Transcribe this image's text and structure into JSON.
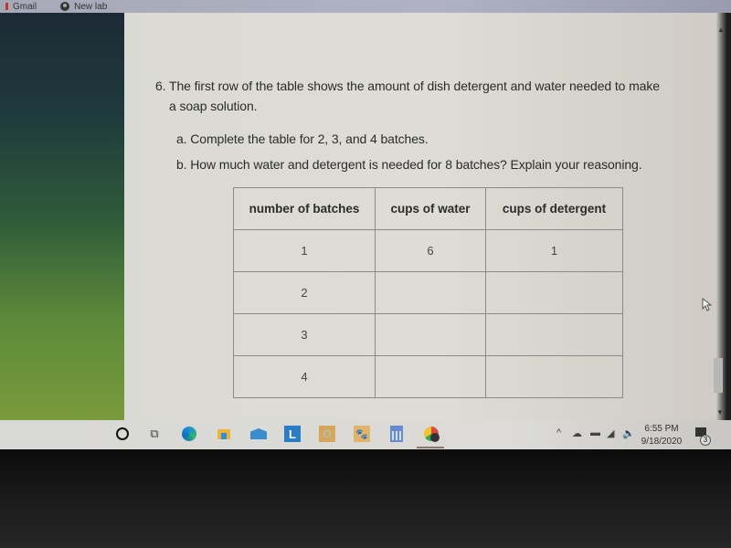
{
  "bookmarks": [
    {
      "label": "Gmail",
      "icon": "gmail-icon"
    },
    {
      "label": "New lab",
      "icon": "globe-icon"
    }
  ],
  "document": {
    "question_line1": "6. The first row of the table shows the amount of dish detergent and water needed to make",
    "question_line2": "a soap solution.",
    "part_a": "a. Complete the table for 2, 3, and 4 batches.",
    "part_b": "b. How much water and detergent is needed for 8 batches? Explain your reasoning.",
    "table": {
      "headers": [
        "number of batches",
        "cups of water",
        "cups of detergent"
      ],
      "rows": [
        [
          "1",
          "6",
          "1"
        ],
        [
          "2",
          "",
          ""
        ],
        [
          "3",
          "",
          ""
        ],
        [
          "4",
          "",
          ""
        ]
      ]
    }
  },
  "taskbar": {
    "apps": [
      "cortana-search",
      "task-view",
      "edge",
      "file-explorer",
      "mail",
      "l-app",
      "orange-app",
      "game-app",
      "calculator",
      "chrome"
    ],
    "lapp_letter": "L",
    "tray": {
      "chevron": "^",
      "time": "6:55 PM",
      "date": "9/18/2020",
      "notification_count": "3"
    }
  }
}
